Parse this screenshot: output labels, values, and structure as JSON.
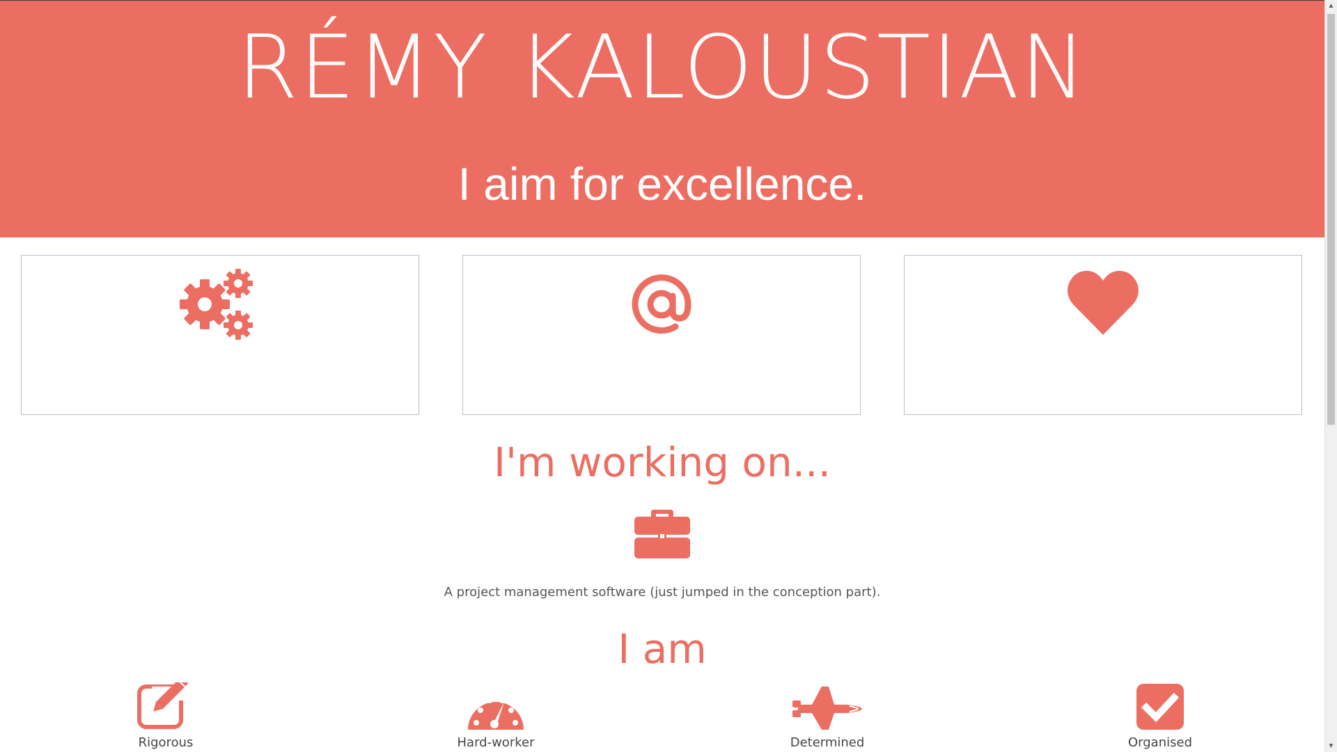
{
  "header": {
    "name": "RÉMY KALOUSTIAN",
    "tagline": "I aim for excellence."
  },
  "cards": [
    {
      "icon": "gears-icon"
    },
    {
      "icon": "at-sign-icon"
    },
    {
      "icon": "heart-icon"
    }
  ],
  "working": {
    "title": "I'm working on...",
    "icon": "briefcase-icon",
    "description": "A project management software (just jumped in the conception part)."
  },
  "iam": {
    "title": "I am",
    "traits": [
      {
        "label": "Rigorous",
        "icon": "edit-pencil-icon"
      },
      {
        "label": "Hard-worker",
        "icon": "speedometer-icon"
      },
      {
        "label": "Determined",
        "icon": "space-shuttle-icon"
      },
      {
        "label": "Organised",
        "icon": "checkbox-icon"
      }
    ]
  },
  "colors": {
    "accent": "#ec6e62",
    "card_border": "#b9bfcc",
    "text": "#444444"
  },
  "scrollbar": {
    "up_arrow": "▲",
    "down_arrow": "▼"
  }
}
